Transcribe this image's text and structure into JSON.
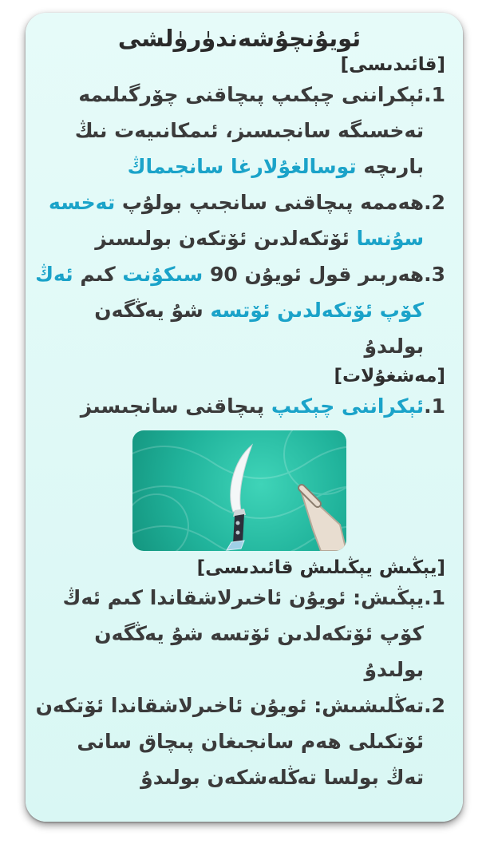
{
  "title": "ئويۇنچۇشەندۈرۈلشى",
  "rules": {
    "heading": "[قائىدىسى]",
    "items": [
      {
        "num": "1.",
        "parts": [
          {
            "t": "ئېكراننى چېكىپ پىچاقنى چۆرگىلىمە تەخسىگە سانجىسىز، ئىمكانىيەت نىڭ بارىچە ",
            "h": false
          },
          {
            "t": "توسالغۇلارغا سانجىماڭ",
            "h": true
          }
        ]
      },
      {
        "num": "2.",
        "parts": [
          {
            "t": "ھەممە پىچاقنى سانجىپ بولۇپ ",
            "h": false
          },
          {
            "t": "تەخسە سۇنسا",
            "h": true
          },
          {
            "t": " ئۆتكەلدىن ئۆتكەن بولىسىز",
            "h": false
          }
        ]
      },
      {
        "num": "3.",
        "parts": [
          {
            "t": "ھەربىر قول ئويۇن 90 ",
            "h": false
          },
          {
            "t": "سىكۇنت",
            "h": true
          },
          {
            "t": " كىم ",
            "h": false
          },
          {
            "t": "ئەڭ كۆپ ئۆتكەلدىن ئۆتسە",
            "h": true
          },
          {
            "t": " شۇ يەڭگەن بولىدۇ",
            "h": false
          }
        ]
      }
    ]
  },
  "task": {
    "heading": "[مەشغۇلات]",
    "items": [
      {
        "num": "1.",
        "parts": [
          {
            "t": "ئېكراننى چېكىپ",
            "h": true
          },
          {
            "t": " پىچاقنى سانجىسىز",
            "h": false
          }
        ]
      }
    ]
  },
  "win": {
    "heading": "[يېڭىش يېڭىلىش قائىدىسى]",
    "items": [
      {
        "num": "1.",
        "parts": [
          {
            "t": "يېڭىش: ئويۇن ئاخىرلاشقاندا كىم ئەڭ كۆپ ئۆتكەلدىن ئۆتسە شۇ يەڭگەن بولىدۇ",
            "h": false
          }
        ]
      },
      {
        "num": "2.",
        "parts": [
          {
            "t": "تەڭلىشىش: ئويۇن ئاخىرلاشقاندا ئۆتكەن ئۆتكىلى ھەم سانجىغان پىچاق سانى تەڭ بولسا تەڭلەشكەن بولىدۇ",
            "h": false
          }
        ]
      }
    ]
  },
  "colors": {
    "accent": "#1ba3c9",
    "text": "#3b3b3b",
    "banner": "#21b49c"
  },
  "icons": {
    "banner_knife": "knife-icon",
    "banner_hand": "tap-hand-icon"
  }
}
